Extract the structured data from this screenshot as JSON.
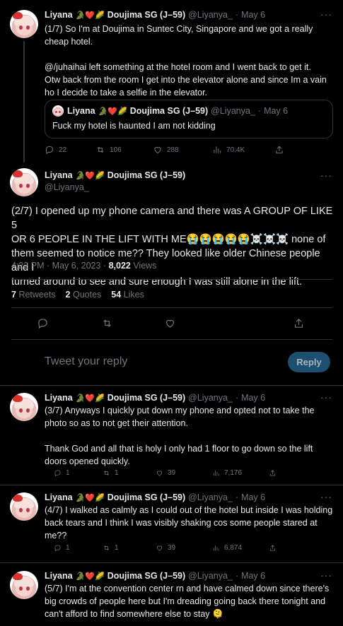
{
  "tweets": [
    {
      "name": "Liyana",
      "badges": "🐊❤️🌽",
      "display_suffix": "Doujima SG (J–59)",
      "handle": "@Liyanya_",
      "dot": "·",
      "date": "May 6",
      "lines": [
        "(1/7) So I'm at Doujima in Suntec City, Singapore and we got a really",
        "cheap hotel.",
        "",
        " @/juhaihai  left something at the hotel room and I went back to get it.",
        "Otw back from the room I get into the elevator alone and since Im a vain",
        "ho I decide to take a selfie in the elevator."
      ],
      "quote": {
        "name": "Liyana",
        "badges": "🐊❤️🌽",
        "display_suffix": "Doujima SG (J–59)",
        "handle": "@Liyanya_",
        "dot": "·",
        "date": "May 6",
        "text": "Fuck my hotel is haunted I am not kidding"
      },
      "replies": "22",
      "retweets": "106",
      "likes": "288",
      "views": "70.4K"
    },
    {
      "name": "Liyana",
      "badges": "🐊❤️🌽",
      "display_suffix": "Doujima SG (J–59)",
      "handle": "@Liyanya_",
      "lines": [
        "(2/7) I opened up my phone camera and there was A GROUP OF LIKE 5",
        "OR 6 PEOPLE IN THE LIFT WITH ME😭😭😭😭😭☠️☠️☠️ none of",
        "them seemed to notice me?? They looked like older Chinese people and I",
        "turned around to see and sure enough I was still alone in the lift."
      ],
      "timestamp": "4:22 PM · May 6, 2023 · ",
      "views_count": "8,022",
      "views_label": " Views",
      "retweets": "7",
      "retweets_label": "Retweets",
      "quotes": "2",
      "quotes_label": "Quotes",
      "likes": "54",
      "likes_label": "Likes"
    },
    {
      "name": "Liyana",
      "badges": "🐊❤️🌽",
      "display_suffix": "Doujima SG (J–59)",
      "handle": "@Liyanya_",
      "dot": "·",
      "date": "May 6",
      "lines": [
        "(3/7) Anyways I quickly put down my phone and opted not to take the",
        "photo so as to not get their attention.",
        "",
        "Thank God and all that is holy I only had 1 floor to go down so the lift",
        "doors opened quickly."
      ],
      "replies": "1",
      "retweets": "1",
      "likes": "39",
      "views": "7,176"
    },
    {
      "name": "Liyana",
      "badges": "🐊❤️🌽",
      "display_suffix": "Doujima SG (J–59)",
      "handle": "@Liyanya_",
      "dot": "·",
      "date": "May 6",
      "lines": [
        "(4/7) I walked as calmly as I could out of the hotel but inside I was holding",
        "back tears and I think I was visibly shaking cos some people stared at",
        "me??"
      ],
      "replies": "1",
      "retweets": "1",
      "likes": "39",
      "views": "6,874"
    },
    {
      "name": "Liyana",
      "badges": "🐊❤️🌽",
      "display_suffix": "Doujima SG (J–59)",
      "handle": "@Liyanya_",
      "dot": "·",
      "date": "May 6",
      "lines": [
        "(5/7) I'm at the convention center rn and have calmed down since there's",
        "big crowds of people here but I'm dreading going back there tonight and",
        "can't afford to find somewhere else to stay 🫠"
      ]
    }
  ],
  "reply_box": {
    "placeholder": "Tweet your reply",
    "button": "Reply"
  },
  "more_glyph": "···",
  "colors": {
    "bg": "#000000",
    "text": "#e7e9ea",
    "muted": "#71767b",
    "border": "#2f3336",
    "reply_button": "#1d4f70"
  }
}
